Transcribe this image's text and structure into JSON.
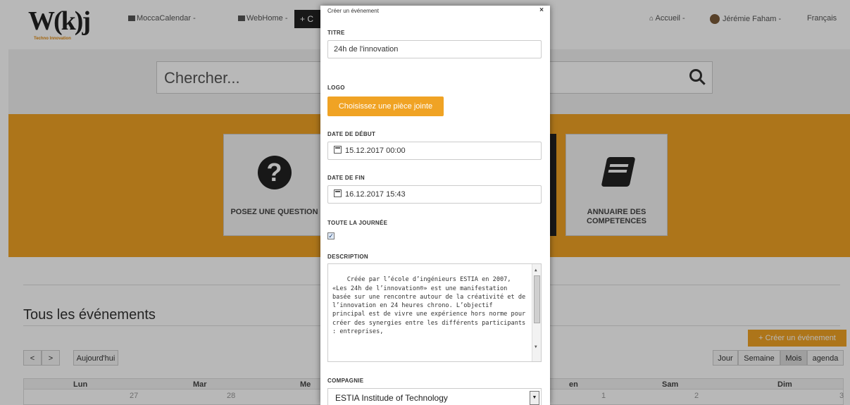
{
  "topbar": {
    "logo_tag": "Techno Innovation",
    "nav": [
      {
        "label": "MoccaCalendar -"
      },
      {
        "label": "WebHome -"
      }
    ],
    "create_short": "+ C",
    "home": "Accueil -",
    "user": "Jérémie Faham -",
    "language": "Français"
  },
  "search": {
    "placeholder": "Chercher..."
  },
  "tiles": {
    "ask": "POSEZ UNE QUESTION",
    "directory": "ANNUAIRE DES COMPETENCES"
  },
  "events": {
    "title": "Tous les événements",
    "today": "Aujourd'hui",
    "prev": "<",
    "next": ">",
    "create_event": "+ Créer un événement",
    "views": [
      "Jour",
      "Semaine",
      "Mois",
      "agenda"
    ],
    "days": [
      "Lun",
      "Mar",
      "Me",
      "en",
      "Sam",
      "Dim"
    ],
    "first_row": [
      "27",
      "28",
      "1",
      "2",
      "3"
    ]
  },
  "modal": {
    "title": "Créer un événement",
    "close": "×",
    "title_label": "TITRE",
    "title_value": "24h de l'innovation",
    "logo_label": "LOGO",
    "attach_button": "Choisissez une pièce jointe",
    "start_label": "DATE DE DÉBUT",
    "start_value": "15.12.2017 00:00",
    "end_label": "DATE DE FIN",
    "end_value": "16.12.2017 15:43",
    "allday_label": "TOUTE LA JOURNÉE",
    "allday_checked": true,
    "description_label": "DESCRIPTION",
    "description": "Créée par l’école d’ingénieurs ESTIA en 2007, «Les 24h de l’innovation®» est une manifestation basée sur une rencontre autour de la créativité et de l’innovation en 24 heures chrono. L’objectif principal est de vivre une expérience hors norme pour créer des synergies entre les différents participants : entreprises,",
    "company_label": "COMPAGNIE",
    "company_value": "ESTIA Institude of Technology"
  },
  "colors": {
    "accent": "#f0a324",
    "dark": "#222222"
  }
}
